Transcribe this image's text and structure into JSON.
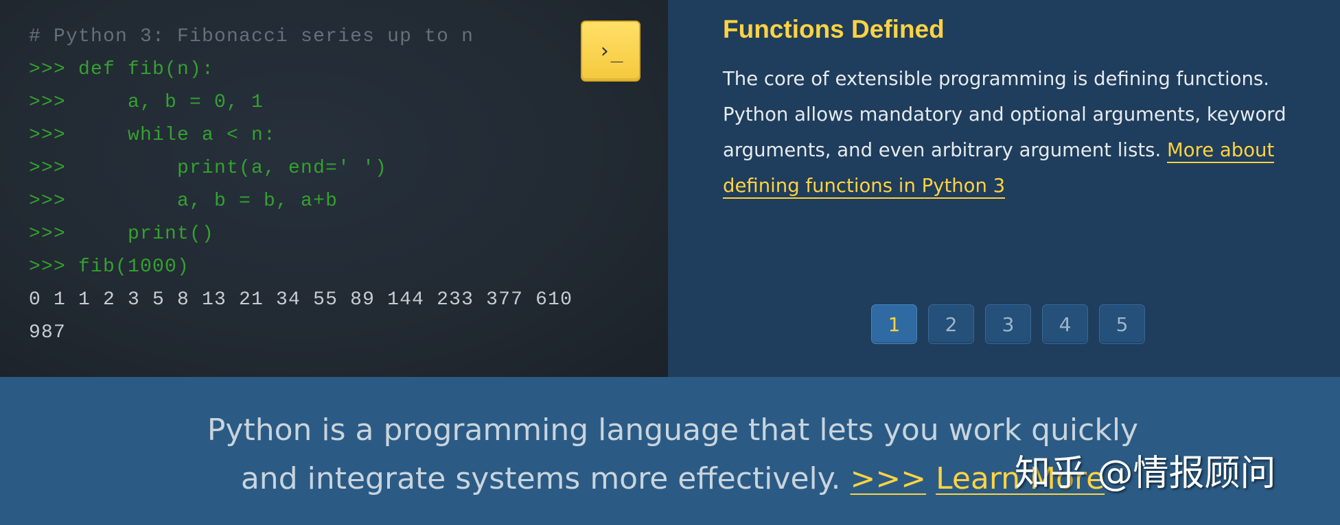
{
  "code": {
    "lines": [
      "# Python 3: Fibonacci series up to n",
      ">>> def fib(n):",
      ">>>     a, b = 0, 1",
      ">>>     while a < n:",
      ">>>         print(a, end=' ')",
      ">>>         a, b = b, a+b",
      ">>>     print()",
      ">>> fib(1000)",
      "0 1 1 2 3 5 8 13 21 34 55 89 144 233 377 610",
      "987"
    ],
    "shell_button_label": "›_"
  },
  "info": {
    "title": "Functions Defined",
    "body": "The core of extensible programming is defining functions. Python allows mandatory and optional arguments, keyword arguments, and even arbitrary argument lists. ",
    "link_text": "More about defining functions in Python 3"
  },
  "pagination": {
    "pages": [
      "1",
      "2",
      "3",
      "4",
      "5"
    ],
    "active": "1"
  },
  "tagline": {
    "line1": "Python is a programming language that lets you work quickly",
    "line2": "and integrate systems more effectively. ",
    "chevrons": ">>>",
    "learn_more": "Learn More"
  },
  "watermark": "知乎 @情报顾问",
  "colors": {
    "accent_yellow": "#ffd342",
    "prompt_green": "#34a12f",
    "panel_navy": "#1f3d5c",
    "band_blue": "#2b5b84"
  }
}
